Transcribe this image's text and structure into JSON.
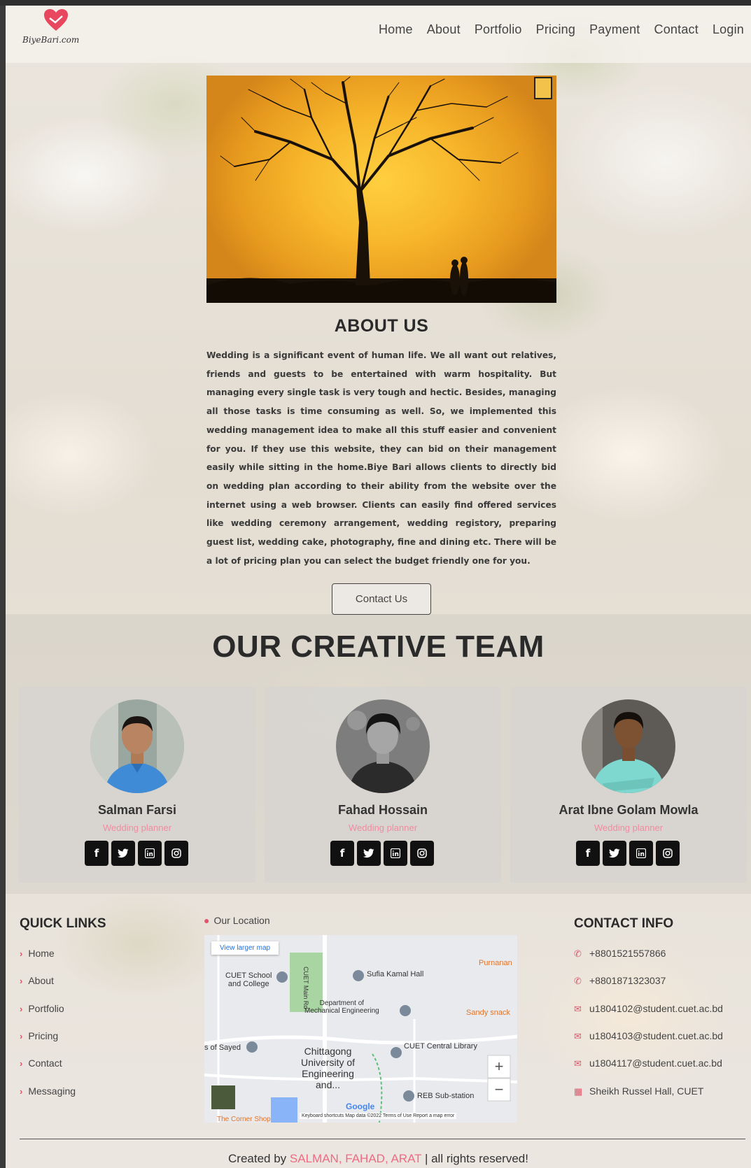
{
  "brand": {
    "logo_text": "BiyeBari.com",
    "accent_color": "#f06a82"
  },
  "nav": {
    "items": [
      {
        "label": "Home"
      },
      {
        "label": "About"
      },
      {
        "label": "Portfolio"
      },
      {
        "label": "Pricing"
      },
      {
        "label": "Payment"
      },
      {
        "label": "Contact"
      },
      {
        "label": "Login"
      }
    ]
  },
  "about": {
    "title": "ABOUT US",
    "text": "Wedding is a significant event of human life. We all want out relatives, friends and guests to be entertained with warm hospitality. But managing every single task is very tough and hectic. Besides, managing all those tasks is time consuming as well. So, we implemented this wedding management idea to make all this stuff easier and convenient for you. If they use this website, they can bid on their management easily while sitting in the home.Biye Bari allows clients to directly bid on wedding plan according to their ability from the website over the internet using a web browser. Clients can easily find offered services like wedding ceremony arrangement, wedding registory, preparing guest list, wedding cake, photography, fine and dining etc. There will be a lot of pricing plan you can select the budget friendly one for you.",
    "button": "Contact Us"
  },
  "team": {
    "title": "OUR CREATIVE TEAM",
    "members": [
      {
        "name": "Salman Farsi",
        "role": "Wedding planner"
      },
      {
        "name": "Fahad Hossain",
        "role": "Wedding planner"
      },
      {
        "name": "Arat Ibne Golam Mowla",
        "role": "Wedding planner"
      }
    ],
    "social_icons": [
      "facebook-icon",
      "twitter-icon",
      "linkedin-icon",
      "instagram-icon"
    ]
  },
  "footer": {
    "quick_links_title": "QUICK LINKS",
    "quick_links": [
      "Home",
      "About",
      "Portfolio",
      "Pricing",
      "Contact",
      "Messaging"
    ],
    "location_label": "Our Location",
    "map": {
      "view_larger": "View larger map",
      "labels": {
        "school": "CUET School\nand College",
        "road": "CUET Main Rd",
        "hall": "Sufia Kamal Hall",
        "purnanan": "Purnanan",
        "dept": "Department of\nMechanical Engineering",
        "snack": "Sandy snack",
        "sayed": "s of Sayed",
        "univ": "Chittagong\nUniversity of\nEngineering\nand...",
        "library": "CUET Central Library",
        "substation": "REB Sub-station",
        "google": "Google",
        "attribution": "Keyboard shortcuts   Map data ©2022   Terms of Use   Report a map error",
        "corner": "The Corner Shop"
      }
    },
    "contact_title": "CONTACT INFO",
    "contacts": [
      {
        "icon": "phone-icon",
        "text": "+8801521557866"
      },
      {
        "icon": "phone-icon",
        "text": "+8801871323037"
      },
      {
        "icon": "mail-icon",
        "text": "u1804102@student.cuet.ac.bd"
      },
      {
        "icon": "mail-icon",
        "text": "u1804103@student.cuet.ac.bd"
      },
      {
        "icon": "mail-icon",
        "text": "u1804117@student.cuet.ac.bd"
      },
      {
        "icon": "map-icon",
        "text": "Sheikh Russel Hall, CUET"
      }
    ],
    "copyright_prefix": "Created by ",
    "copyright_names": "SALMAN, FAHAD, ARAT",
    "copyright_suffix": " | all rights reserved!"
  }
}
